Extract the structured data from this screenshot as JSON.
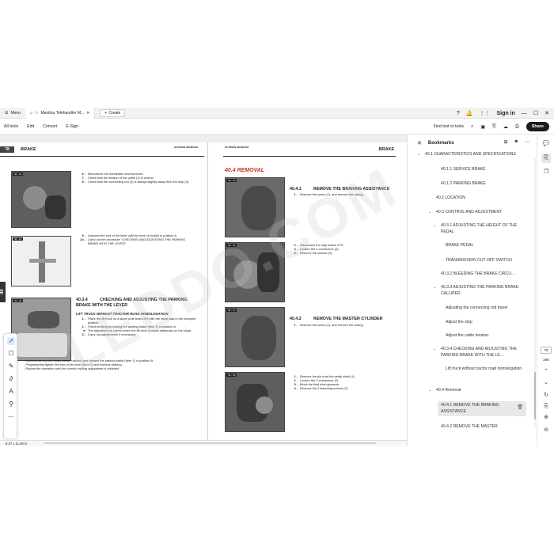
{
  "tabbar": {
    "menu_label": "Menu",
    "doc_tab_title": "Manitou Telehandler M...",
    "create_label": "Create",
    "signin_label": "Sign in"
  },
  "toolbar": {
    "items": [
      "All tools",
      "Edit",
      "Convert",
      "E-Sign"
    ],
    "find_label": "Find text or tools",
    "share_label": "Share"
  },
  "page_left": {
    "page_number": "78",
    "section": "BRAKE",
    "version": "647780EN 06/08/2018",
    "photos": [
      "40 - 13",
      "40 - 14",
      "40 - 15"
    ],
    "steps_a": [
      {
        "n": "6 -",
        "t": "Manoeuvre the handbrake several times."
      },
      {
        "n": "7 -",
        "t": "Check that the tension of the cable (1) is correct."
      },
      {
        "n": "8 -",
        "t": "Check that the connecting rod (2) is always slightly away from the stop (3)."
      }
    ],
    "steps_b": [
      {
        "n": "9 -",
        "t": "Unscrew the end of the lever until the lever is locked in position A."
      },
      {
        "n": "10 -",
        "t": "Carry out the procedure \"CHECKING AND ADJUSTING THE PARKING BRAKE WITH THE LEVER\"."
      }
    ],
    "heading_num": "40.3.4",
    "heading_text": "CHECKING AND ADJUSTING THE PARKING BRAKE WITH THE LEVER",
    "subheading": "LIFT TRUCK WITHOUT TRACTOR ROAD HOMOLOGATION",
    "steps_c": [
      {
        "n": "1 -",
        "t": "Place the lift truck on a slope of at least 15% with the rated load in the transport position."
      },
      {
        "n": "2 -",
        "t": "Check braking by locking the parking brake (Item 1) in position A."
      },
      {
        "n": "⇨",
        "t": "The adjustment is correct when the lift truck remains stationary on the slope."
      },
      {
        "n": "3 -",
        "t": "Carry out adjustments if necessary:"
      }
    ],
    "bullets": [
      "- Depress the service brake pedal, unblock and release the parking brake (Item 1) in position B.",
      "- Progressively tighten the end of the lever (Item 1) and recheck braking.",
      "- Repeat the operation until the correct braking adjustment is obtained."
    ],
    "side_tab": "40"
  },
  "page_right": {
    "version": "647780EN 06/08/2018",
    "section": "BRAKE",
    "main_heading": "40.4  REMOVAL",
    "photos": [
      "40 - 16",
      "40 - 16",
      "40 - 17",
      "40 - 18"
    ],
    "h1_num": "40.4.1",
    "h1_text": "REMOVE THE BRAKING ASSISTANCE",
    "steps_1": [
      {
        "n": "1 -",
        "t": "Remove the screw (1), and remove the casing."
      }
    ],
    "steps_2": [
      {
        "n": "2 -",
        "t": "Disconnect the stop switch X73."
      },
      {
        "n": "3 -",
        "t": "Loosen the 2 connectors (2)."
      },
      {
        "n": "4 -",
        "t": "Remove the screws (3)."
      }
    ],
    "h2_num": "40.4.2",
    "h2_text": "REMOVE THE MASTER CYLINDER",
    "steps_3": [
      {
        "n": "1 -",
        "t": "Remove the screw (1), and remove the casing."
      }
    ],
    "steps_4": [
      {
        "n": "1 -",
        "t": "Remove the pin from the pedal shaft (1)."
      },
      {
        "n": "2 -",
        "t": "Loosen the 3 connectors (2)."
      },
      {
        "n": "3 -",
        "t": "Block the fluid inlet pipework."
      },
      {
        "n": "4 -",
        "t": "Remove the 2 fastening screws (3)."
      }
    ]
  },
  "status": {
    "page_size": "8,27 x 11,69 in"
  },
  "bookmarks": {
    "title": "Bookmarks",
    "items": [
      {
        "label": "40.1 CHARACTERISTICS AND SPECIFICATIONS",
        "chev": "⌄"
      },
      {
        "label": "40.1.1 SERVICE BRAKE",
        "chev": ""
      },
      {
        "label": "40.1.2 PARKING BRAKE",
        "chev": ""
      },
      {
        "label": "40.2 LOCATION",
        "chev": ""
      },
      {
        "label": "40.3 CONTROL AND ADJUSTMENT",
        "chev": "⌄"
      },
      {
        "label": "40.3.1 ADJUSTING THE HEIGHT OF THE PEDAL",
        "chev": "⌄"
      },
      {
        "label": "BRAKE PEDAL",
        "chev": ""
      },
      {
        "label": "TRANSMISSION CUT-OFF SWITCH",
        "chev": ""
      },
      {
        "label": "40.3.2 BLEEDING THE BRAKE CIRCU...",
        "chev": ""
      },
      {
        "label": "40.3.3 ADJUSTING THE PARKING BRAKE CALLIPER",
        "chev": "⌄"
      },
      {
        "label": "Adjusting the connecting rod travel",
        "chev": ""
      },
      {
        "label": "Adjust the stop",
        "chev": ""
      },
      {
        "label": "Adjust the cable tension.",
        "chev": ""
      },
      {
        "label": "40.3.4 CHECKING AND ADJUSTING THE PARKING BRAKE WITH THE LE...",
        "chev": "⌄"
      },
      {
        "label": "Lift truck without tractor road homologation",
        "chev": ""
      },
      {
        "label": "40.4 Removal",
        "chev": "⌄"
      },
      {
        "label": "40.4.1 REMOVE THE BRAKING ASSISTANCE",
        "chev": ""
      },
      {
        "label": "40.4.2 REMOVE THE MASTER",
        "chev": ""
      }
    ]
  },
  "rail": {
    "current_page": "78",
    "total_pages": "266"
  },
  "watermark": "LEDDO.COM",
  "colors": {
    "accent_red": "#c0392b",
    "active_blue": "#1664d8",
    "share_bg": "#1a1a1a"
  }
}
